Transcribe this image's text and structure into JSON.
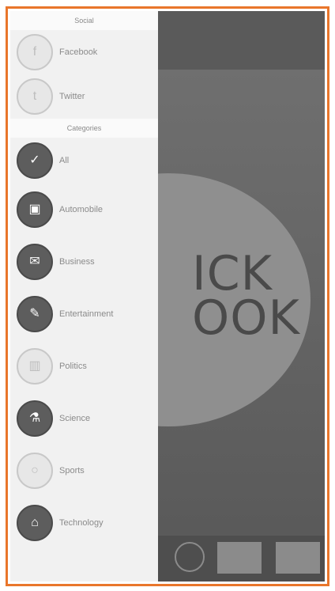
{
  "background": {
    "logo_lines": [
      "ICK",
      "OOK"
    ],
    "tagline": "  ...  "
  },
  "drawer": {
    "sections": [
      {
        "header": "Social",
        "items": [
          {
            "label": "Facebook",
            "icon": "facebook-icon",
            "style": "light",
            "glyph": "f"
          },
          {
            "label": "Twitter",
            "icon": "twitter-icon",
            "style": "light",
            "glyph": "t"
          }
        ]
      },
      {
        "header": "Categories",
        "items": [
          {
            "label": "All",
            "icon": "checkmark-icon",
            "style": "dark",
            "glyph": "✓"
          },
          {
            "label": "Automobile",
            "icon": "car-icon",
            "style": "dark",
            "glyph": "▣"
          },
          {
            "label": "Business",
            "icon": "briefcase-icon",
            "style": "dark",
            "glyph": "✉"
          },
          {
            "label": "Entertainment",
            "icon": "brush-icon",
            "style": "dark",
            "glyph": "✎"
          },
          {
            "label": "Politics",
            "icon": "building-icon",
            "style": "light",
            "glyph": "▥"
          },
          {
            "label": "Science",
            "icon": "microscope-icon",
            "style": "dark",
            "glyph": "⚗"
          },
          {
            "label": "Sports",
            "icon": "ball-icon",
            "style": "light",
            "glyph": "○"
          },
          {
            "label": "Technology",
            "icon": "device-icon",
            "style": "dark",
            "glyph": "⌂"
          }
        ]
      }
    ]
  },
  "colors": {
    "frame": "#e9762b",
    "drawer_bg": "#f1f1f1"
  }
}
